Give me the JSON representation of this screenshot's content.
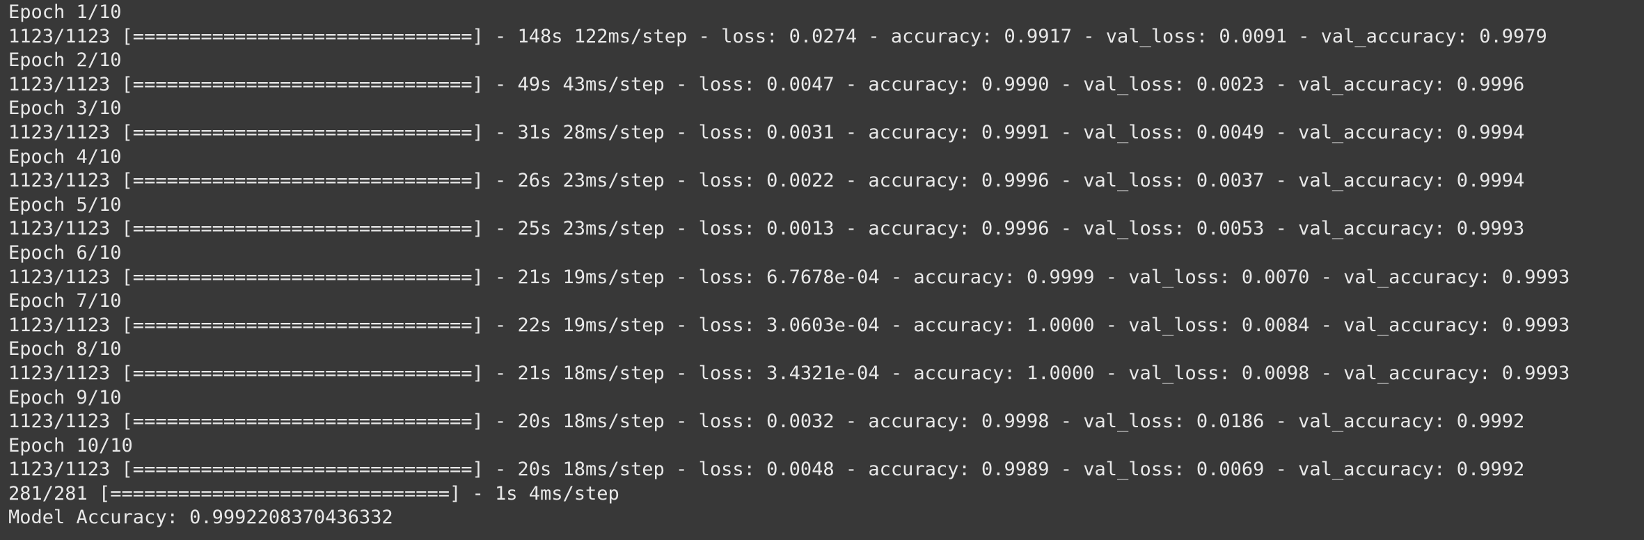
{
  "terminal": {
    "lines": [
      "Epoch 1/10",
      "1123/1123 [==============================] - 148s 122ms/step - loss: 0.0274 - accuracy: 0.9917 - val_loss: 0.0091 - val_accuracy: 0.9979",
      "Epoch 2/10",
      "1123/1123 [==============================] - 49s 43ms/step - loss: 0.0047 - accuracy: 0.9990 - val_loss: 0.0023 - val_accuracy: 0.9996",
      "Epoch 3/10",
      "1123/1123 [==============================] - 31s 28ms/step - loss: 0.0031 - accuracy: 0.9991 - val_loss: 0.0049 - val_accuracy: 0.9994",
      "Epoch 4/10",
      "1123/1123 [==============================] - 26s 23ms/step - loss: 0.0022 - accuracy: 0.9996 - val_loss: 0.0037 - val_accuracy: 0.9994",
      "Epoch 5/10",
      "1123/1123 [==============================] - 25s 23ms/step - loss: 0.0013 - accuracy: 0.9996 - val_loss: 0.0053 - val_accuracy: 0.9993",
      "Epoch 6/10",
      "1123/1123 [==============================] - 21s 19ms/step - loss: 6.7678e-04 - accuracy: 0.9999 - val_loss: 0.0070 - val_accuracy: 0.9993",
      "Epoch 7/10",
      "1123/1123 [==============================] - 22s 19ms/step - loss: 3.0603e-04 - accuracy: 1.0000 - val_loss: 0.0084 - val_accuracy: 0.9993",
      "Epoch 8/10",
      "1123/1123 [==============================] - 21s 18ms/step - loss: 3.4321e-04 - accuracy: 1.0000 - val_loss: 0.0098 - val_accuracy: 0.9993",
      "Epoch 9/10",
      "1123/1123 [==============================] - 20s 18ms/step - loss: 0.0032 - accuracy: 0.9998 - val_loss: 0.0186 - val_accuracy: 0.9992",
      "Epoch 10/10",
      "1123/1123 [==============================] - 20s 18ms/step - loss: 0.0048 - accuracy: 0.9989 - val_loss: 0.0069 - val_accuracy: 0.9992",
      "281/281 [==============================] - 1s 4ms/step",
      "Model Accuracy: 0.9992208370436332"
    ]
  }
}
